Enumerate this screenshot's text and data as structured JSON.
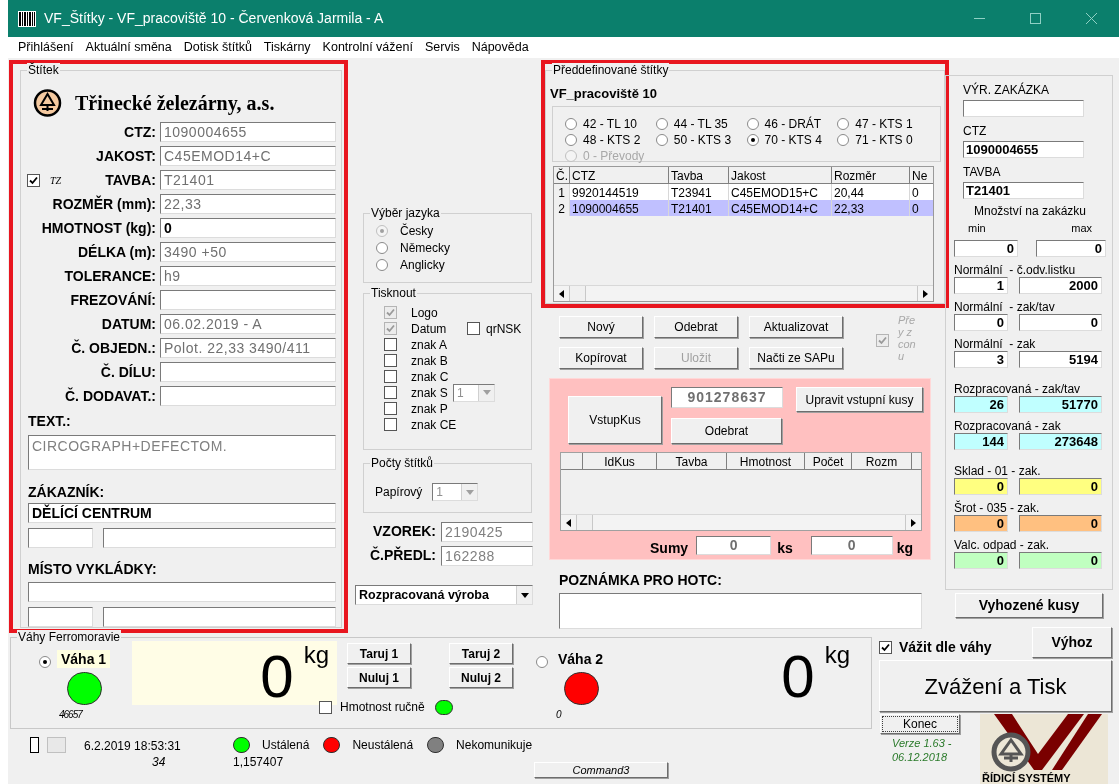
{
  "window": {
    "title": "VF_Štítky - VF_pracoviště 10 - Červenková Jarmila - A"
  },
  "menu": [
    "Přihlášení",
    "Aktuální směna",
    "Dotisk štítků",
    "Tiskárny",
    "Kontrolní vážení",
    "Servis",
    "Nápověda"
  ],
  "label_panel": {
    "title": "Štítek",
    "company": "Třinecké železárny, a.s.",
    "fields": [
      {
        "label": "CTZ:",
        "value": "1090004655",
        "disabled": true
      },
      {
        "label": "JAKOST:",
        "value": "C45EMOD14+C",
        "disabled": true
      },
      {
        "label": "TAVBA:",
        "value": "T21401",
        "disabled": true,
        "flag": {
          "checked": true,
          "text": "TZ"
        }
      },
      {
        "label": "ROZMĚR (mm):",
        "value": "22,33",
        "disabled": true
      },
      {
        "label": "HMOTNOST (kg):",
        "value": "0",
        "disabled": false
      },
      {
        "label": "DÉLKA (m):",
        "value": "3490 +50",
        "disabled": true
      },
      {
        "label": "TOLERANCE:",
        "value": "h9",
        "disabled": true
      },
      {
        "label": "FREZOVÁNÍ:"
      },
      {
        "label": "DATUM:",
        "value": "06.02.2019 - A",
        "disabled": true
      },
      {
        "label": "Č. OBJEDN.:",
        "value": "Polot. 22,33 3490/411",
        "disabled": true
      },
      {
        "label": "Č. DÍLU:"
      },
      {
        "label": "Č. DODAVAT.:"
      }
    ],
    "text": {
      "label": "TEXT.:",
      "value": "CIRCOGRAPH+DEFECTOM."
    },
    "customer": {
      "label": "ZÁKAZNÍK:",
      "value": "DĚLÍCÍ CENTRUM"
    },
    "unloading": {
      "label": "MÍSTO VYKLÁDKY:"
    }
  },
  "language": {
    "title": "Výběr jazyka",
    "options": [
      {
        "label": "Česky",
        "selected": true,
        "disabled": true
      },
      {
        "label": "Německy",
        "selected": false,
        "disabled": false
      },
      {
        "label": "Anglicky",
        "selected": false,
        "disabled": false
      }
    ]
  },
  "print": {
    "title": "Tisknout",
    "options": [
      {
        "label": "Logo",
        "checked": true,
        "disabled": true
      },
      {
        "label": "Datum",
        "checked": true,
        "disabled": true
      },
      {
        "label": "znak A",
        "checked": false,
        "disabled": false
      },
      {
        "label": "znak B",
        "checked": false,
        "disabled": false
      },
      {
        "label": "znak C",
        "checked": false,
        "disabled": false
      },
      {
        "label": "znak S",
        "checked": false,
        "disabled": false
      },
      {
        "label": "znak P",
        "checked": false,
        "disabled": false
      },
      {
        "label": "znak CE",
        "checked": false,
        "disabled": false
      }
    ],
    "qr": {
      "label": "qrNSK",
      "checked": false
    },
    "s_select": {
      "value": "1"
    }
  },
  "counts": {
    "title": "Počty štítků",
    "label": "Papírový",
    "value": "1"
  },
  "sample": [
    {
      "label": "VZOREK:",
      "value": "2190425"
    },
    {
      "label": "Č.PŘEDL:",
      "value": "162288"
    }
  ],
  "production_select": {
    "value": "Rozpracovaná výroba"
  },
  "predefined": {
    "title": "Předdefinované štítky",
    "workplace": "VF_pracoviště 10",
    "options": [
      {
        "label": "42 - TL 10",
        "selected": false,
        "disabled": false
      },
      {
        "label": "44 - TL 35",
        "selected": false,
        "disabled": false
      },
      {
        "label": "46 - DRÁT",
        "selected": false,
        "disabled": false
      },
      {
        "label": "47 - KTS 1",
        "selected": false,
        "disabled": false
      },
      {
        "label": "48 - KTS 2",
        "selected": false,
        "disabled": false
      },
      {
        "label": "50 - KTS 3",
        "selected": false,
        "disabled": false
      },
      {
        "label": "70 - KTS 4",
        "selected": true,
        "disabled": false
      },
      {
        "label": "71 - KTS 0",
        "selected": false,
        "disabled": false
      },
      {
        "label": "0 - Převody",
        "selected": false,
        "disabled": true
      }
    ],
    "table": {
      "columns": [
        "Č.",
        "CTZ",
        "Tavba",
        "Jakost",
        "Rozměr",
        "Ne"
      ],
      "rows": [
        {
          "cells": [
            "1",
            "9920144519",
            "T23941",
            "C45EMOD15+C",
            "20,44",
            "0"
          ],
          "selected": false
        },
        {
          "cells": [
            "2",
            "1090004655",
            "T21401",
            "C45EMOD14+C",
            "22,33",
            "0"
          ],
          "selected": true
        }
      ]
    }
  },
  "buttons": [
    {
      "label": "Nový",
      "disabled": false
    },
    {
      "label": "Odebrat",
      "disabled": false
    },
    {
      "label": "Aktualizovat",
      "disabled": false
    },
    {
      "label": "Kopírovat",
      "disabled": false
    },
    {
      "label": "Uložit",
      "disabled": true
    },
    {
      "label": "Načti ze SAPu",
      "disabled": false
    }
  ],
  "side_check": {
    "checked": true,
    "lines": [
      "Pře",
      "y z",
      "con",
      "u"
    ]
  },
  "input_pieces": {
    "button": "VstupKus",
    "code": "901278637",
    "edit_button": "Upravit vstupní kusy",
    "remove_button": "Odebrat",
    "columns": [
      "IdKus",
      "Tavba",
      "Hmotnost",
      "Počet",
      "Rozm"
    ],
    "sum_label": "Sumy",
    "count": "0",
    "count_unit": "ks",
    "weight": "0",
    "weight_unit": "kg"
  },
  "note": {
    "label": "POZNÁMKA PRO HOTC:"
  },
  "order": {
    "order_label": "VÝR. ZAKÁZKA",
    "ctz_label": "CTZ",
    "ctz": "1090004655",
    "tavba_label": "TAVBA",
    "tavba": "T21401",
    "qty_label": "Množství na zakázku",
    "min_label": "min",
    "max_label": "max",
    "min": "0",
    "max": "0",
    "counters": [
      {
        "label": "Normální  - č.odv.listku",
        "values": [
          "1",
          "2000"
        ],
        "color": "#ffffff"
      },
      {
        "label": "Normální  - zak/tav",
        "values": [
          "0",
          "0"
        ],
        "color": "#ffffff"
      },
      {
        "label": "Normální  - zak",
        "values": [
          "3",
          "5194"
        ],
        "color": "#ffffff"
      },
      {
        "label": "Rozpracovaná - zak/tav",
        "values": [
          "26",
          "51770"
        ],
        "color": "#c0ffff"
      },
      {
        "label": "Rozpracovaná - zak",
        "values": [
          "144",
          "273648"
        ],
        "color": "#c0ffff"
      },
      {
        "label": "Sklad - 01 - zak.",
        "values": [
          "0",
          "0"
        ],
        "color": "#ffff80"
      },
      {
        "label": "Šrot - 035 - zak.",
        "values": [
          "0",
          "0"
        ],
        "color": "#ffc080"
      },
      {
        "label": "Valc. odpad - zak.",
        "values": [
          "0",
          "0"
        ],
        "color": "#c0ffc0"
      }
    ],
    "discard_button": "Vyhozené kusy"
  },
  "scales": {
    "title": "Váhy Ferromoravie",
    "items": [
      {
        "label": "Váha 1",
        "selected": true,
        "color": "#00ff00",
        "count": "46657",
        "weight": "0",
        "unit": "kg",
        "tare": "Taruj 1",
        "zero": "Nuluj 1"
      },
      {
        "label": "Váha 2",
        "selected": false,
        "color": "#ff0000",
        "count": "0",
        "weight": "0",
        "unit": "kg",
        "tare": "Taruj 2",
        "zero": "Nuluj 2"
      }
    ],
    "manual": {
      "label": "Hmotnost ručně",
      "checked": false
    }
  },
  "weigh": {
    "by_scale": {
      "label": "Vážit dle váhy",
      "checked": true
    },
    "eject": "Výhoz",
    "main": "Zvážení a Tisk",
    "exit": "Konec",
    "version": "Verze 1.63 - 06.12.2018",
    "logo": "ŘÍDICÍ SYSTÉMY"
  },
  "status": {
    "datetime": "6.2.2019 18:53:31",
    "counter": "34",
    "ratio": "1,157407",
    "legend": [
      {
        "label": "Ustálená",
        "color": "#00ff00"
      },
      {
        "label": "Neustálená",
        "color": "#ff0000"
      },
      {
        "label": "Nekomunikuje",
        "color": "#808080"
      }
    ],
    "command": "Command3"
  }
}
